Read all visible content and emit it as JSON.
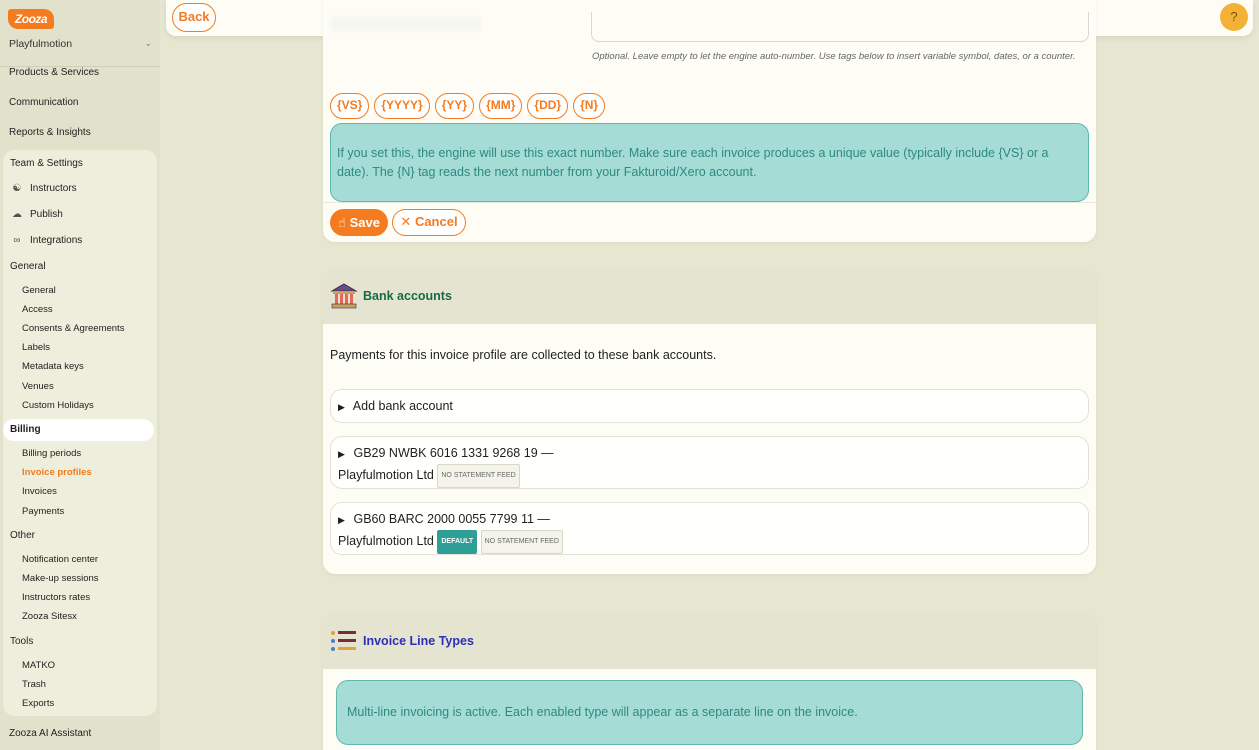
{
  "brand": {
    "logo_text": "Zooza",
    "accent": "#f47b20"
  },
  "sidebar": {
    "org": "Playfulmotion",
    "top_items": [
      "Products & Services",
      "Communication",
      "Reports & Insights"
    ],
    "team_heading": "Team & Settings",
    "team_items": [
      {
        "label": "Instructors",
        "icon": "user-icon"
      },
      {
        "label": "Publish",
        "icon": "cloud-upload-icon"
      },
      {
        "label": "Integrations",
        "icon": "link-icon"
      }
    ],
    "general_heading": "General",
    "general_items": [
      "General",
      "Access",
      "Consents & Agreements",
      "Labels",
      "Metadata keys",
      "Venues",
      "Custom Holidays"
    ],
    "billing_heading": "Billing",
    "billing_items": [
      "Billing periods",
      "Invoice profiles",
      "Invoices",
      "Payments"
    ],
    "other_heading": "Other",
    "other_items": [
      "Notification center",
      "Make-up sessions",
      "Instructors rates",
      "Zooza Sitesx"
    ],
    "tools_heading": "Tools",
    "tools_items": [
      "MATKO",
      "Trash",
      "Exports"
    ],
    "assistant": "Zooza AI Assistant"
  },
  "topbar": {
    "back_label": "Back",
    "help_label": "?"
  },
  "numbering": {
    "hint": "Optional. Leave empty to let the engine auto-number. Use tags below to insert variable symbol, dates, or a counter.",
    "tags": [
      "{VS}",
      "{YYYY}",
      "{YY}",
      "{MM}",
      "{DD}",
      "{N}"
    ],
    "info": "If you set this, the engine will use this exact number. Make sure each invoice produces a unique value (typically include {VS} or a date). The {N} tag reads the next number from your Fakturoid/Xero account.",
    "save_label": "Save",
    "cancel_label": "Cancel"
  },
  "bank_accounts": {
    "title": "Bank accounts",
    "description": "Payments for this invoice profile are collected to these bank accounts.",
    "add_label": "Add bank account",
    "accounts": [
      {
        "iban": "GB29 NWBK 6016 1331 9268 19 —",
        "holder": "Playfulmotion Ltd",
        "default": "",
        "feed": "NO STATEMENT FEED"
      },
      {
        "iban": "GB60 BARC 2000 0055 7799 11 —",
        "holder": "Playfulmotion Ltd",
        "default": "DEFAULT",
        "feed": "NO STATEMENT FEED"
      }
    ]
  },
  "invoice_lines": {
    "title": "Invoice Line Types",
    "info": "Multi-line invoicing is active. Each enabled type will appear as a separate line on the invoice."
  }
}
